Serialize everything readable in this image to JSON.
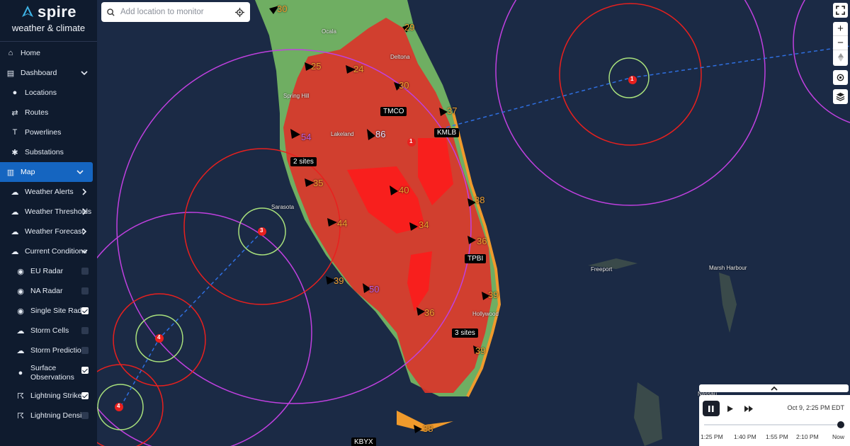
{
  "brand": {
    "name": "spire",
    "subtitle": "weather & climate"
  },
  "search": {
    "placeholder": "Add location to monitor"
  },
  "nav": [
    {
      "id": "home",
      "label": "Home",
      "icon": "home-icon",
      "level": 0
    },
    {
      "id": "dashboard",
      "label": "Dashboard",
      "icon": "dashboard-icon",
      "level": 0,
      "chevron": "down"
    },
    {
      "id": "locations",
      "label": "Locations",
      "icon": "location-pin-icon",
      "level": 1
    },
    {
      "id": "routes",
      "label": "Routes",
      "icon": "routes-icon",
      "level": 1
    },
    {
      "id": "powerlines",
      "label": "Powerlines",
      "icon": "powerline-icon",
      "level": 1
    },
    {
      "id": "substations",
      "label": "Substations",
      "icon": "substation-icon",
      "level": 1
    },
    {
      "id": "map",
      "label": "Map",
      "icon": "map-icon",
      "level": 0,
      "chevron": "down",
      "active": true
    },
    {
      "id": "weather-alerts",
      "label": "Weather Alerts",
      "icon": "alert-icon",
      "level": 1,
      "chevron": "right"
    },
    {
      "id": "weather-thresholds",
      "label": "Weather Thresholds",
      "icon": "thresholds-icon",
      "level": 1,
      "chevron": "right"
    },
    {
      "id": "weather-forecast",
      "label": "Weather Forecast",
      "icon": "forecast-icon",
      "level": 1,
      "chevron": "right"
    },
    {
      "id": "current-conditions",
      "label": "Current Conditions",
      "icon": "conditions-icon",
      "level": 1,
      "chevron": "down"
    },
    {
      "id": "eu-radar",
      "label": "EU Radar",
      "icon": "radar-icon",
      "level": 2,
      "checked": false
    },
    {
      "id": "na-radar",
      "label": "NA Radar",
      "icon": "radar-icon",
      "level": 2,
      "checked": false
    },
    {
      "id": "single-site-radar",
      "label": "Single Site Radar",
      "icon": "radar-icon",
      "level": 2,
      "checked": true
    },
    {
      "id": "storm-cells",
      "label": "Storm Cells",
      "icon": "storm-cloud-icon",
      "level": 2,
      "checked": false
    },
    {
      "id": "storm-prediction",
      "label": "Storm Prediction",
      "icon": "storm-prediction-icon",
      "level": 2,
      "checked": false
    },
    {
      "id": "surface-observations",
      "label": "Surface Observations",
      "icon": "location-pin-icon",
      "level": 2,
      "checked": true,
      "tall": true
    },
    {
      "id": "lightning-strikes",
      "label": "Lightning Strikes",
      "icon": "lightning-icon",
      "level": 2,
      "checked": true
    },
    {
      "id": "lightning-density",
      "label": "Lightning Density",
      "icon": "lightning-icon",
      "level": 2,
      "checked": false
    }
  ],
  "map": {
    "site_labels": [
      "TMCO",
      "KMLB",
      "2 sites",
      "TPBI",
      "3 sites",
      "KBYX"
    ],
    "cities": [
      "Ocala",
      "Deltona",
      "Spring Hill",
      "Lakeland",
      "Sarasota",
      "Hollywood",
      "Freeport",
      "Marsh Harbour",
      "Nassau"
    ],
    "storm_numbers": [
      "30",
      "29",
      "25",
      "24",
      "30",
      "37",
      "54",
      "86",
      "35",
      "40",
      "38",
      "44",
      "34",
      "36",
      "39",
      "50",
      "36",
      "39",
      "39",
      "38"
    ],
    "markers": [
      "1",
      "1",
      "3",
      "4",
      "4"
    ]
  },
  "timeline": {
    "current_time": "Oct 9, 2:25 PM EDT",
    "ticks": [
      "1:25 PM",
      "1:40 PM",
      "1:55 PM",
      "2:10 PM",
      "Now"
    ]
  },
  "colors": {
    "sidebar_bg": "#0f1b2e",
    "accent": "#1565c0",
    "ocean": "#1b2a45",
    "warning_red": "#e8201e",
    "range_ring_purple": "#c040e0"
  }
}
